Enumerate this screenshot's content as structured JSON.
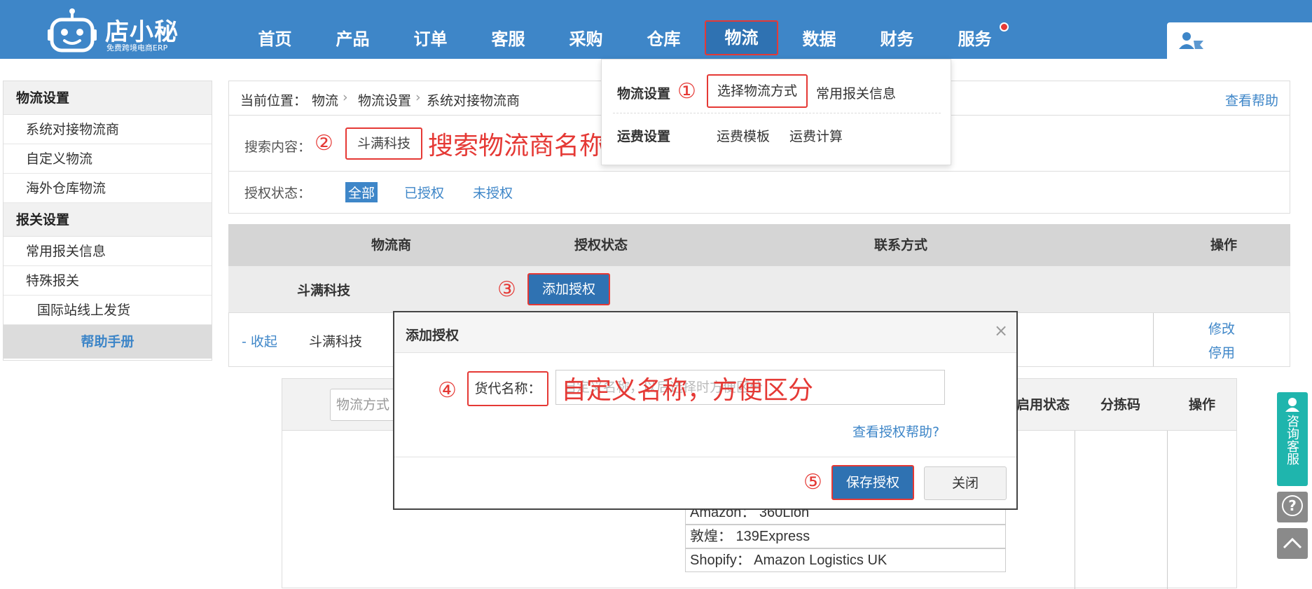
{
  "brand": {
    "name": "店小秘",
    "slogan": "免费跨境电商ERP"
  },
  "nav": [
    {
      "label": "首页"
    },
    {
      "label": "产品"
    },
    {
      "label": "订单"
    },
    {
      "label": "客服"
    },
    {
      "label": "采购"
    },
    {
      "label": "仓库"
    },
    {
      "label": "物流"
    },
    {
      "label": "数据"
    },
    {
      "label": "财务"
    },
    {
      "label": "服务"
    }
  ],
  "nav_active": "物流",
  "sidebar": {
    "sections": [
      {
        "title": "物流设置",
        "items": [
          "系统对接物流商",
          "自定义物流",
          "海外仓库物流"
        ]
      },
      {
        "title": "报关设置",
        "items": [
          "常用报关信息",
          "特殊报关"
        ]
      }
    ],
    "sub_item": "国际站线上发货",
    "help": "帮助手册"
  },
  "breadcrumb": {
    "label": "当前位置：",
    "path": [
      "物流",
      "物流设置",
      "系统对接物流商"
    ],
    "help": "查看帮助"
  },
  "search": {
    "label": "搜索内容：",
    "value": "斗满科技",
    "annotation": "搜索物流商名称"
  },
  "auth_filter": {
    "label": "授权状态：",
    "options": [
      "全部",
      "已授权",
      "未授权"
    ],
    "selected": "全部"
  },
  "table": {
    "headers": [
      "物流商",
      "授权状态",
      "联系方式",
      "操作"
    ],
    "group_name": "斗满科技",
    "add_auth": "添加授权",
    "row": {
      "toggle": "- 收起",
      "name": "斗满科技",
      "actions": [
        "修改",
        "停用"
      ]
    }
  },
  "sub_table": {
    "search_placeholder": "物流方式",
    "headers": [
      "启用状态",
      "分拣码",
      "操作"
    ],
    "contacts": [
      "Amazon：  360Lion",
      "敦煌：  139Express",
      "Shopify：  Amazon Logistics UK"
    ]
  },
  "dropdown": {
    "rows": [
      {
        "title": "物流设置",
        "items": [
          "选择物流方式",
          "常用报关信息"
        ]
      },
      {
        "title": "运费设置",
        "items": [
          "运费模板",
          "运费计算"
        ]
      }
    ]
  },
  "modal": {
    "title": "添加授权",
    "close": "×",
    "field_label": "货代名称：",
    "field_placeholder": "自定义名称，以后选择时方便区分",
    "field_annotation": "自定义名称，方便区分",
    "help_link": "查看授权帮助?",
    "save": "保存授权",
    "cancel": "关闭"
  },
  "steps": [
    "①",
    "②",
    "③",
    "④",
    "⑤"
  ],
  "float": {
    "consult": "咨询客服",
    "help_icon": "?"
  },
  "colors": {
    "primary": "#3e86c8",
    "annotation": "#e53935",
    "button": "#2f72b2"
  }
}
